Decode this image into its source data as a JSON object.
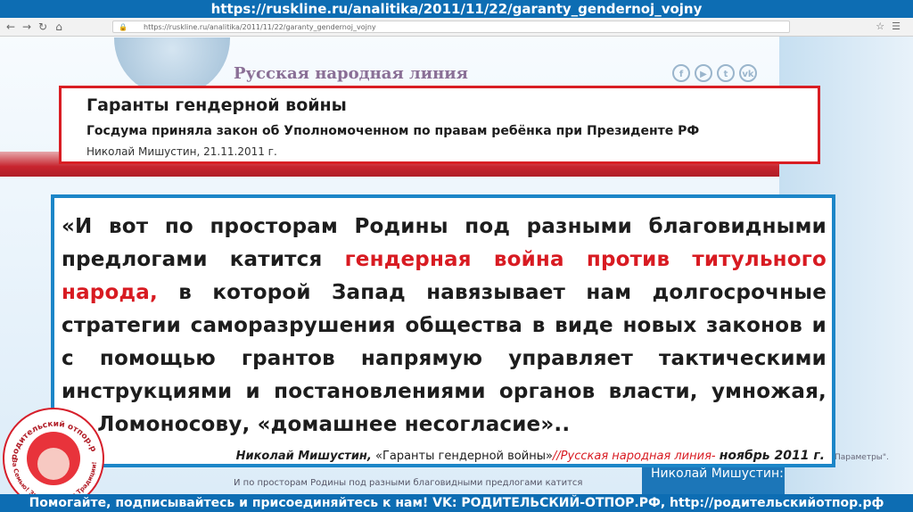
{
  "top_banner": "https://ruskline.ru/analitika/2011/11/22/garanty_gendernoj_vojny",
  "browser": {
    "url": "https://ruskline.ru/analitika/2011/11/22/garanty_gendernoj_vojny"
  },
  "site": {
    "name": "Русская народная линия",
    "social": [
      "f",
      "▶",
      "t",
      "vk"
    ]
  },
  "article": {
    "title": "Гаранты гендерной войны",
    "subtitle": "Госдума приняла закон об Уполномоченном по правам ребёнка при Президенте РФ",
    "author_date": "Николай Мишустин, 21.11.2011 г."
  },
  "quote": {
    "part1": "«И вот по просторам Родины под разными благовидными предлогами катится ",
    "highlight": "гендерная война против титульного народа,",
    "part2": " в которой Запад навязывает нам долгосрочные стратегии саморазрушения общества в виде новых законов и с помощью грантов напрямую управляет тактическими инструкциями и постановлениями органов власти, умножая, по Ломоносову, «домашнее несогласие»..",
    "credit_author": "Николай Мишустин,",
    "credit_title": " «Гаранты гендерной войны»",
    "credit_source": "//Русская народная линия- ",
    "credit_date": "ноябрь 2011 г."
  },
  "underlying": {
    "text": "И по просторам Родины под разными благовидными предлогами катится",
    "param": "Параметры\".",
    "side_card": "Николай Мишустин:"
  },
  "stamp": {
    "arc_text": "родительский отпор.рф",
    "bottom_text": "За Семью! За Родину! За Традиции!"
  },
  "bottom_banner": "Помогайте, подписывайтесь и присоединяйтесь к нам! VK: РОДИТЕЛЬСКИЙ-ОТПОР.РФ, http://родительскийотпор.рф",
  "colors": {
    "banner_blue": "#0d6db3",
    "title_border_red": "#d91e24",
    "quote_border_blue": "#1c86c8",
    "highlight_red": "#d81b22"
  }
}
